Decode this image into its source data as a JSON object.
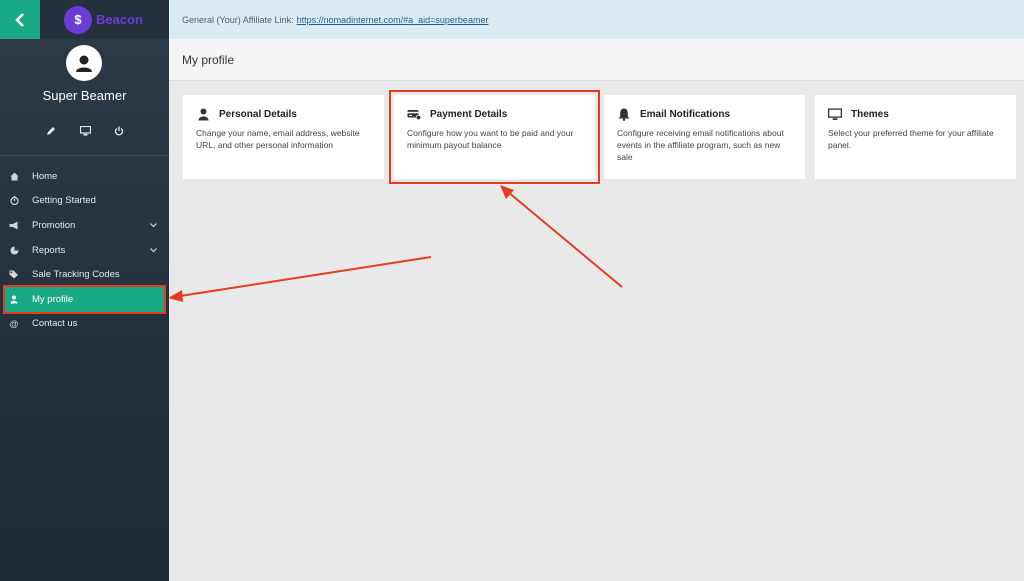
{
  "sidebar": {
    "brand_name": "Beacon",
    "brand_logo_glyph": "$",
    "user_name": "Super Beamer",
    "actions": [
      {
        "icon": "pencil-icon"
      },
      {
        "icon": "monitor-icon"
      },
      {
        "icon": "power-icon"
      }
    ],
    "nav": [
      {
        "label": "Home",
        "icon": "home-icon"
      },
      {
        "label": "Getting Started",
        "icon": "timer-icon"
      },
      {
        "label": "Promotion",
        "icon": "megaphone-icon",
        "expandable": true
      },
      {
        "label": "Reports",
        "icon": "pie-chart-icon",
        "expandable": true
      },
      {
        "label": "Sale Tracking Codes",
        "icon": "tags-icon"
      },
      {
        "label": "My profile",
        "icon": "user-icon",
        "active": true
      },
      {
        "label": "Contact us",
        "icon": "at-icon"
      }
    ]
  },
  "topbar": {
    "label": "General (Your) Affiliate Link:",
    "link": "https://nomadinternet.com/#a_aid=superbeamer"
  },
  "page": {
    "title": "My profile"
  },
  "cards": [
    {
      "title": "Personal Details",
      "icon": "user-icon",
      "desc": "Change your name, email address, website URL, and other personal information"
    },
    {
      "title": "Payment Details",
      "icon": "credit-card-icon",
      "desc": "Configure how you want to be paid and your minimum payout balance"
    },
    {
      "title": "Email Notifications",
      "icon": "bell-icon",
      "desc": "Configure receiving email notifications about events in the affiliate program, such as new sale"
    },
    {
      "title": "Themes",
      "icon": "monitor-icon",
      "desc": "Select your preferred theme for your affiliate panel."
    }
  ],
  "colors": {
    "accent": "#1aa985",
    "highlight": "#e53b1f",
    "brand": "#6a3cd6"
  }
}
